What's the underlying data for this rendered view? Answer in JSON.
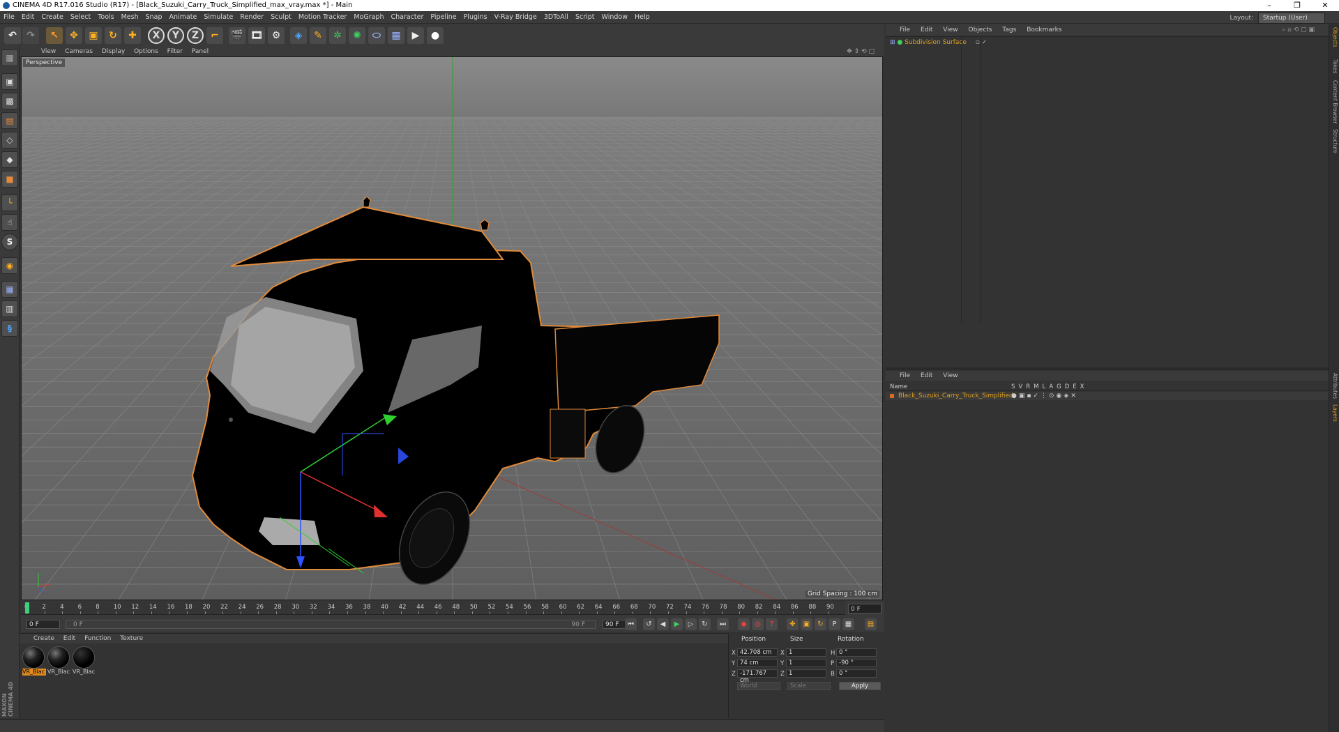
{
  "window": {
    "title": "CINEMA 4D R17.016 Studio (R17) - [Black_Suzuki_Carry_Truck_Simplified_max_vray.max *] - Main",
    "controls": [
      "–",
      "❐",
      "✕"
    ]
  },
  "menubar": {
    "items": [
      "File",
      "Edit",
      "Create",
      "Select",
      "Tools",
      "Mesh",
      "Snap",
      "Animate",
      "Simulate",
      "Render",
      "Sculpt",
      "Motion Tracker",
      "MoGraph",
      "Character",
      "Pipeline",
      "Plugins",
      "V-Ray Bridge",
      "3DToAll",
      "Script",
      "Window",
      "Help"
    ],
    "layout_label": "Layout:",
    "layout_value": "Startup (User)"
  },
  "toolbar": {
    "icons": [
      "undo-icon",
      "redo-icon",
      "select-icon",
      "move-icon",
      "scale-icon",
      "rotate-icon",
      "add-icon",
      "x-axis-icon",
      "y-axis-icon",
      "z-axis-icon",
      "coord-system-icon",
      "render-view-icon",
      "render-picture-icon",
      "render-settings-icon",
      "cube-icon",
      "pen-icon",
      "subdivision-icon",
      "array-icon",
      "deformer-icon",
      "floor-icon",
      "camera-icon",
      "light-icon"
    ],
    "axis_labels": [
      "X",
      "Y",
      "Z"
    ]
  },
  "left_tools": {
    "icons": [
      "make-editable-icon",
      "model-mode-icon",
      "texture-mode-icon",
      "workplane-icon",
      "points-mode-icon",
      "edges-mode-icon",
      "polygons-mode-icon",
      "axis-mode-icon",
      "tweak-icon",
      "snap-icon",
      "magnet-icon",
      "workplane-grid-icon",
      "lock-icon",
      "python-icon"
    ],
    "snap_label": "S"
  },
  "viewport": {
    "menu": [
      "View",
      "Cameras",
      "Display",
      "Options",
      "Filter",
      "Panel"
    ],
    "camera_label": "Perspective",
    "grid_spacing": "Grid Spacing : 100 cm"
  },
  "timeline": {
    "ticks": [
      "0",
      "2",
      "4",
      "6",
      "8",
      "10",
      "12",
      "14",
      "16",
      "18",
      "20",
      "22",
      "24",
      "26",
      "28",
      "30",
      "32",
      "34",
      "36",
      "38",
      "40",
      "42",
      "44",
      "46",
      "48",
      "50",
      "52",
      "54",
      "56",
      "58",
      "60",
      "62",
      "64",
      "66",
      "68",
      "70",
      "72",
      "74",
      "76",
      "78",
      "80",
      "82",
      "84",
      "86",
      "88",
      "90"
    ],
    "current_frame": "0 F"
  },
  "transport": {
    "start_field": "0 F",
    "range_start": "0 F",
    "range_end": "90 F",
    "end_field": "90 F"
  },
  "material_panel": {
    "menu": [
      "Create",
      "Edit",
      "Function",
      "Texture"
    ],
    "materials": [
      {
        "label": "VR_Blac",
        "selected": true
      },
      {
        "label": "VR_Blac",
        "selected": false
      },
      {
        "label": "VR_Blac",
        "selected": false
      }
    ]
  },
  "coordinates": {
    "headers": {
      "position": "Position",
      "size": "Size",
      "rotation": "Rotation"
    },
    "rows": [
      {
        "axis": "X",
        "pos": "42.708 cm",
        "size_axis": "X",
        "size": "1",
        "rot_axis": "H",
        "rot": "0 °"
      },
      {
        "axis": "Y",
        "pos": "74 cm",
        "size_axis": "Y",
        "size": "1",
        "rot_axis": "P",
        "rot": "-90 °"
      },
      {
        "axis": "Z",
        "pos": "-171.767 cm",
        "size_axis": "Z",
        "size": "1",
        "rot_axis": "B",
        "rot": "0 °"
      }
    ],
    "mode_world": "World",
    "mode_scale": "Scale",
    "apply_label": "Apply"
  },
  "brand": {
    "maxon": "MAXON",
    "cinema": "CINEMA 4D"
  },
  "object_manager": {
    "menu": [
      "File",
      "Edit",
      "View",
      "Objects",
      "Tags",
      "Bookmarks"
    ],
    "objects": [
      {
        "name": "Subdivision Surface"
      }
    ]
  },
  "layer_manager": {
    "menu": [
      "File",
      "Edit",
      "View"
    ],
    "columns": [
      "Name",
      "S",
      "V",
      "R",
      "M",
      "L",
      "A",
      "G",
      "D",
      "E",
      "X"
    ],
    "layers": [
      {
        "name": "Black_Suzuki_Carry_Truck_Simplified",
        "color": "#e06a20"
      }
    ]
  },
  "side_tabs": [
    "Objects",
    "Takes",
    "Content Browser",
    "Structure",
    "Attributes",
    "Layers"
  ],
  "colors": {
    "accent": "#e0a020",
    "selection_outline": "#e08a3a"
  }
}
